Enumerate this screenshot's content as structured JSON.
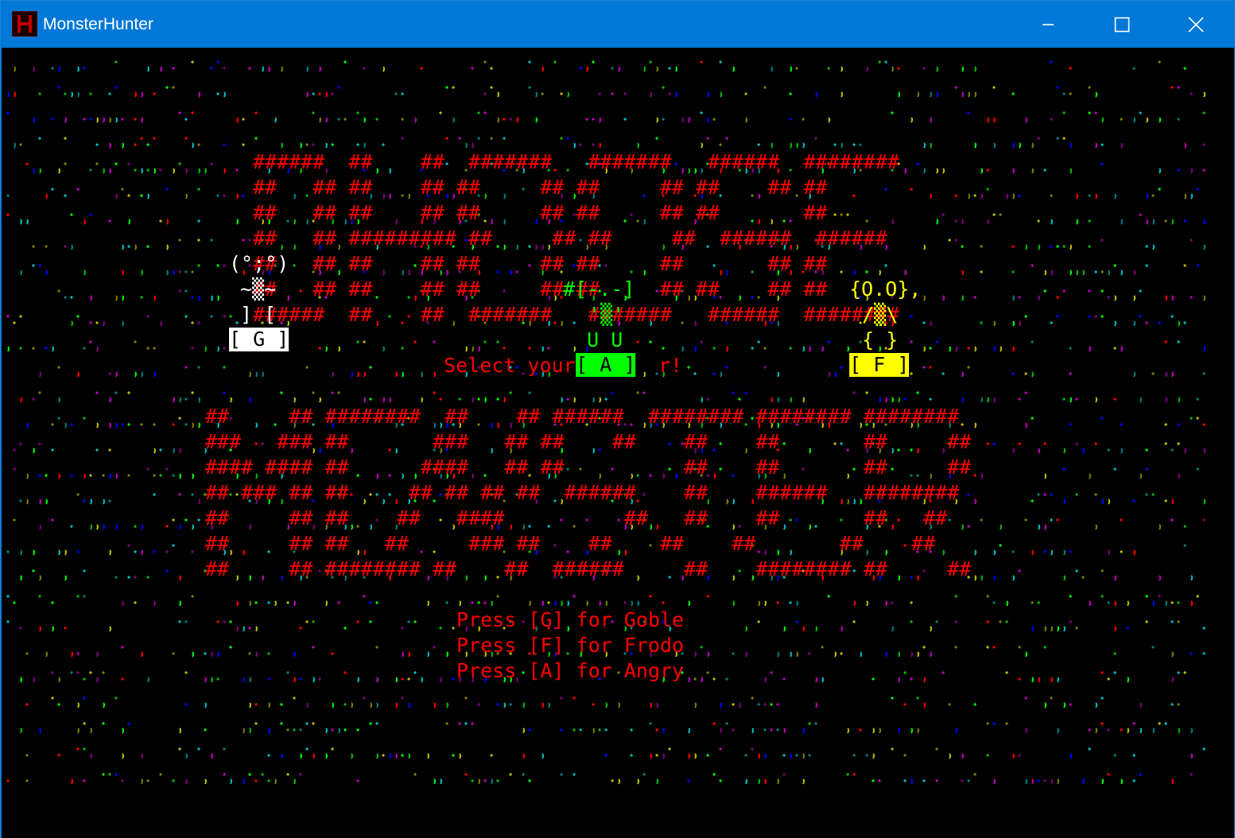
{
  "window": {
    "title": "MonsterHunter",
    "icon": "monsterhunter-app-icon",
    "controls": [
      "minimize-icon",
      "maximize-icon",
      "close-icon"
    ]
  },
  "colors": {
    "titlebar": "#0078d7",
    "console_bg": "#000000",
    "banner": "#ff0000",
    "goble": "#ffffff",
    "angry": "#00ff00",
    "frodo": "#ffff00"
  },
  "banner_top": [
    "######  ##    ##  #######   #######   ######  ########",
    "##   ## ##    ## ##     ## ##     ## ##    ## ##",
    "##   ## ##    ## ##     ## ##     ## ##       ##",
    "##   ## ######### ##     ## ##     ##  ######  ######",
    "##   ## ##    ## ##     ## ##     ##       ## ##",
    "##   ## ##    ## ##     ## ##     ## ##    ## ##",
    "######  ##    ##  #######   #######   ######  ########"
  ],
  "banner_bottom": [
    "##     ## ########  ##    ## ######  ######## ######## ########",
    "###   ### ##       ###   ## ##    ##    ##    ##       ##     ##",
    "#### #### ##      ####   ## ##          ##    ##       ##     ##",
    "## ### ## ##     ## ## ## ##  ######    ##    ######   ########",
    "##     ## ##    ##   ####          ##   ##    ##       ##   ##",
    "##     ## ##   ##     ### ##    ##    ##    ##       ##    ##",
    "##     ## ######## ##    ##  ######     ##    ######## ##     ##"
  ],
  "prompt": {
    "before": "Select your",
    "after": "r!"
  },
  "characters": {
    "goble": {
      "face": "(°;°)",
      "body": "~▒~",
      "legs": "] [",
      "key_label": "[ G ]"
    },
    "angry": {
      "face": "#[-.-]",
      "body": "'▒'",
      "legs": "U U",
      "key_label": "[ A ]"
    },
    "frodo": {
      "face": "{O.O},",
      "body": "/▒\\",
      "legs": "{ }",
      "key_label": "[ F ]"
    }
  },
  "instructions": [
    "Press [G] for Goble",
    "Press [F] for Frodo",
    "Press [A] for Angry"
  ]
}
